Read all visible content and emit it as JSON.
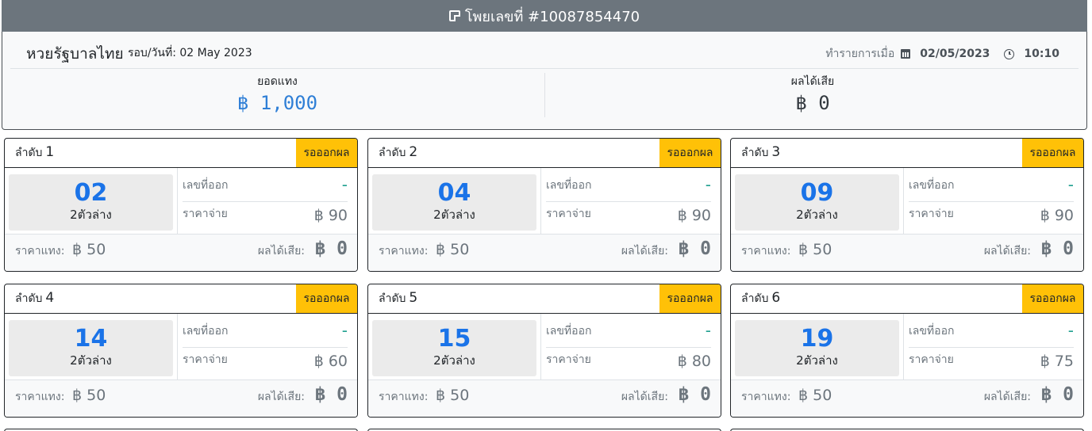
{
  "header": {
    "title": "โพยเลขที่ #10087854470",
    "icon": "ticket-icon"
  },
  "summary": {
    "lottery_name": "หวยรัฐบาลไทย",
    "round_label": "รอบ/วันที่: 02 May 2023",
    "tx_label": "ทำรายการเมื่อ",
    "tx_date": "02/05/2023",
    "tx_time": "10:10",
    "bet_total_label": "ยอดแทง",
    "bet_total_value": "฿ 1,000",
    "profit_label": "ผลได้เสีย",
    "profit_value": "฿ 0",
    "bet_total_color": "#2f7fd6"
  },
  "labels": {
    "seq": "ลำดับ",
    "status": "รอออกผล",
    "drawn": "เลขที่ออก",
    "payout": "ราคาจ่าย",
    "bet": "ราคาแทง:",
    "profit": "ผลได้เสีย:"
  },
  "colors": {
    "status_bg": "#ffc107",
    "number": "#1a73e8",
    "header_bg": "#6c757d"
  },
  "items": [
    {
      "seq": "1",
      "number": "02",
      "type": "2ตัวล่าง",
      "drawn": "-",
      "payout": "฿ 90",
      "bet": "฿ 50",
      "profit": "฿ 0"
    },
    {
      "seq": "2",
      "number": "04",
      "type": "2ตัวล่าง",
      "drawn": "-",
      "payout": "฿ 90",
      "bet": "฿ 50",
      "profit": "฿ 0"
    },
    {
      "seq": "3",
      "number": "09",
      "type": "2ตัวล่าง",
      "drawn": "-",
      "payout": "฿ 90",
      "bet": "฿ 50",
      "profit": "฿ 0"
    },
    {
      "seq": "4",
      "number": "14",
      "type": "2ตัวล่าง",
      "drawn": "-",
      "payout": "฿ 60",
      "bet": "฿ 50",
      "profit": "฿ 0"
    },
    {
      "seq": "5",
      "number": "15",
      "type": "2ตัวล่าง",
      "drawn": "-",
      "payout": "฿ 80",
      "bet": "฿ 50",
      "profit": "฿ 0"
    },
    {
      "seq": "6",
      "number": "19",
      "type": "2ตัวล่าง",
      "drawn": "-",
      "payout": "฿ 75",
      "bet": "฿ 50",
      "profit": "฿ 0"
    }
  ]
}
